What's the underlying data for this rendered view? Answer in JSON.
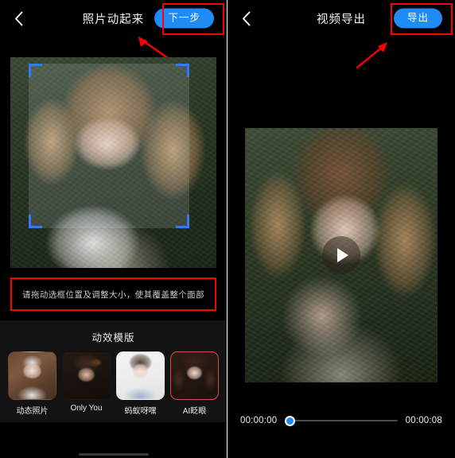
{
  "left_screen": {
    "header": {
      "back_icon": "chevron-left-icon",
      "title": "照片动起来",
      "action_label": "下一步"
    },
    "photo_editor": {
      "selection_box_hint": "face-selection-frame",
      "corner_handles": 4
    },
    "tip": {
      "text": "请拖动选框位置及调整大小，使其覆盖整个面部"
    },
    "templates": {
      "section_title": "动效模版",
      "items": [
        {
          "label": "动态照片",
          "selected": false
        },
        {
          "label": "Only You",
          "selected": false
        },
        {
          "label": "蚂蚁呀嘿",
          "selected": false
        },
        {
          "label": "AI眨眼",
          "selected": true
        }
      ]
    }
  },
  "right_screen": {
    "header": {
      "back_icon": "chevron-left-icon",
      "title": "视频导出",
      "action_label": "导出"
    },
    "player": {
      "play_icon": "play-icon"
    },
    "timeline": {
      "current_time": "00:00:00",
      "total_time": "00:00:08",
      "progress_percent": 0
    }
  },
  "annotations": {
    "highlight_color": "#ff0000",
    "arrow_left": "red-arrow-pointing-to-next-button",
    "arrow_right": "red-arrow-pointing-to-export-button"
  },
  "colors": {
    "accent_blue": "#1f8cf5",
    "selection_blue": "#2f7bf0",
    "background": "#000000",
    "highlight_red": "#ff0000",
    "template_selected_border": "#d4504a"
  }
}
